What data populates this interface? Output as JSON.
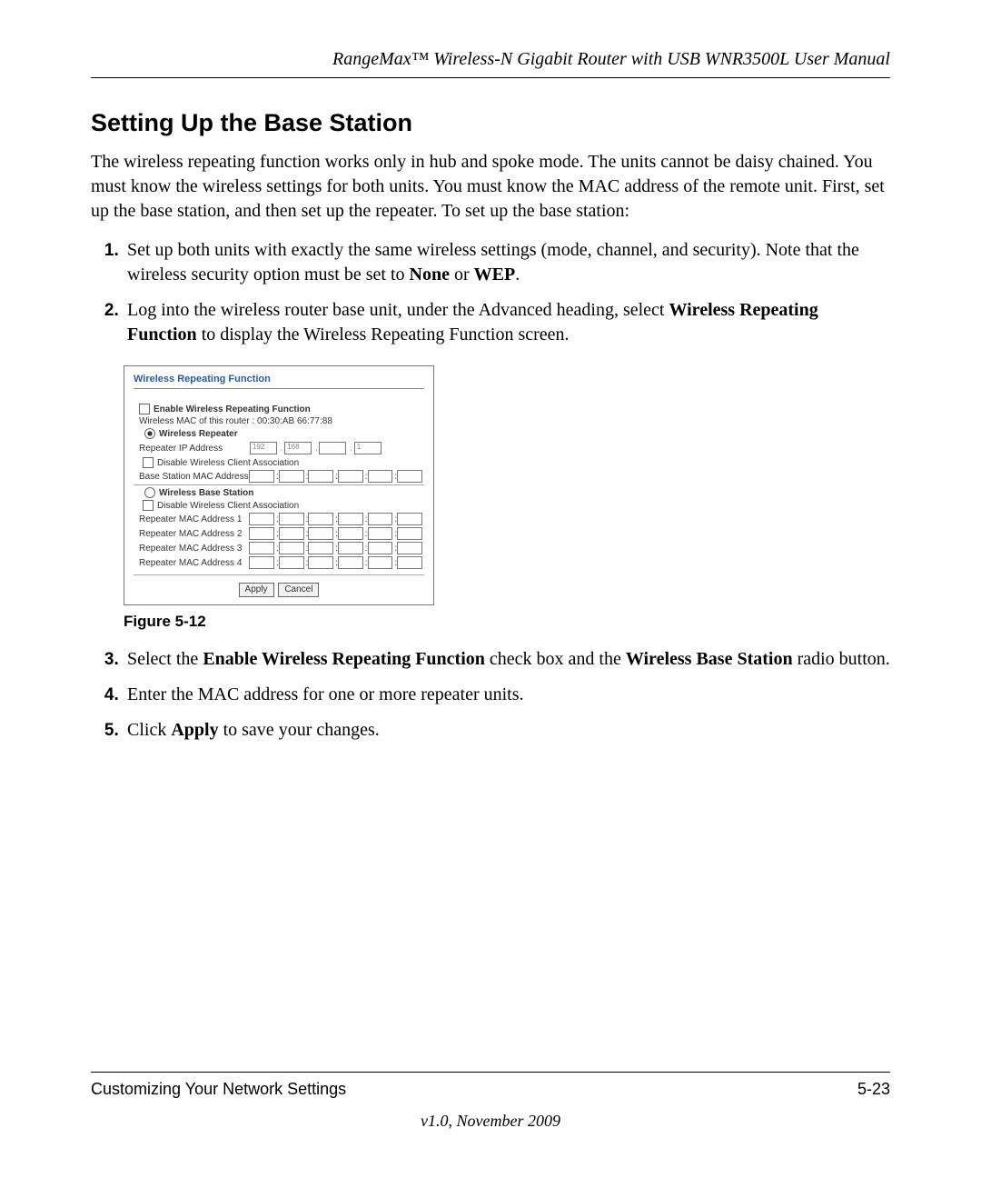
{
  "header": {
    "doc_title": "RangeMax™ Wireless-N Gigabit Router with USB WNR3500L User Manual"
  },
  "section": {
    "title": "Setting Up the Base Station",
    "intro": "The wireless repeating function works only in hub and spoke mode. The units cannot be daisy chained. You must know the wireless settings for both units. You must know the MAC address of the remote unit. First, set up the base station, and then set up the repeater. To set up the base station:"
  },
  "steps": {
    "s1a": "Set up both units with exactly the same wireless settings (mode, channel, and security). Note that the wireless security option must be set to ",
    "s1b1": "None",
    "s1c": " or ",
    "s1b2": "WEP",
    "s1d": ".",
    "s2a": "Log into the wireless router base unit, under the Advanced heading, select ",
    "s2b": "Wireless Repeating Function",
    "s2c": " to display the Wireless Repeating Function screen.",
    "s3a": "Select the ",
    "s3b1": "Enable Wireless Repeating Function",
    "s3c": " check box and the ",
    "s3b2": "Wireless Base Station",
    "s3d": " radio button.",
    "s4": "Enter the MAC address for one or more repeater units.",
    "s5a": "Click ",
    "s5b": "Apply",
    "s5c": " to save your changes."
  },
  "figure": {
    "caption": "Figure 5-12",
    "panel_title": "Wireless Repeating Function",
    "enable_label": "Enable Wireless Repeating Function",
    "mac_info": "Wireless MAC of this router : 00:30:AB 66:77:88",
    "repeater_label": "Wireless Repeater",
    "repeater_ip_label": "Repeater IP Address",
    "ip": {
      "a": "192",
      "b": "168",
      "c": "",
      "d": "1"
    },
    "disable_assoc": "Disable Wireless Client Association",
    "base_mac_label": "Base Station MAC Address",
    "base_station_label": "Wireless Base Station",
    "rep_mac1": "Repeater MAC Address 1",
    "rep_mac2": "Repeater MAC Address 2",
    "rep_mac3": "Repeater MAC Address 3",
    "rep_mac4": "Repeater MAC Address 4",
    "apply_btn": "Apply",
    "cancel_btn": "Cancel"
  },
  "footer": {
    "left": "Customizing Your Network Settings",
    "right": "5-23",
    "version": "v1.0, November 2009"
  }
}
